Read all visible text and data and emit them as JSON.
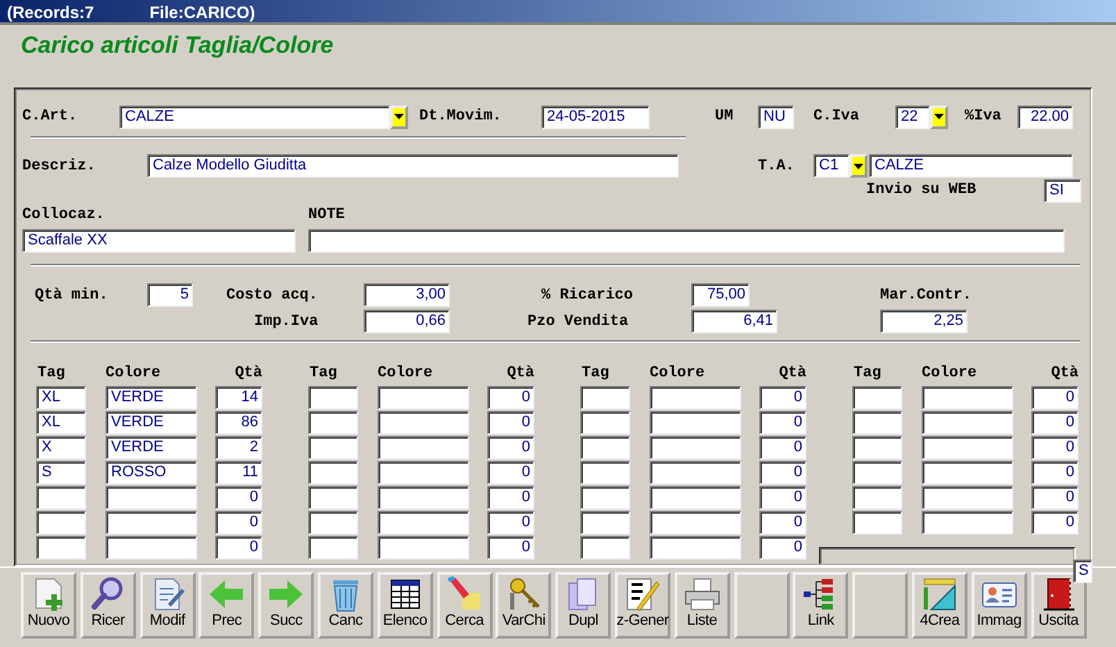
{
  "window": {
    "records": "(Records:7",
    "file": "File:CARICO)"
  },
  "heading": "Carico articoli Taglia/Colore",
  "article": {
    "label": "C.Art.",
    "value": "CALZE"
  },
  "date": {
    "label": "Dt.Movim.",
    "value": "24-05-2015"
  },
  "unit": {
    "label": "UM",
    "value": "NU"
  },
  "vat_code": {
    "label": "C.Iva",
    "value": "22"
  },
  "vat_rate": {
    "label": "%Iva",
    "value": "22.00"
  },
  "description": {
    "label": "Descriz.",
    "value": "Calze Modello Giuditta"
  },
  "product_type": {
    "label": "T.A.",
    "code": "C1",
    "name": "CALZE"
  },
  "web": {
    "label": "Invio su WEB",
    "value": "SI"
  },
  "location": {
    "label": "Collocaz.",
    "value": "Scaffale XX"
  },
  "notes": {
    "label": "NOTE"
  },
  "min_qty": {
    "label": "Qtà min.",
    "value": "5"
  },
  "cost": {
    "label": "Costo acq.",
    "value": "3,00"
  },
  "markup": {
    "label": "% Ricarico",
    "value": "75,00"
  },
  "margin": {
    "label": "Mar.Contr.",
    "value": "2,25"
  },
  "vat_amount": {
    "label": "Imp.Iva",
    "value": "0,66"
  },
  "sale_price": {
    "label": "Pzo Vendita",
    "value": "6,41"
  },
  "variant_groups": [
    {
      "columns": [
        "Tag",
        "Colore",
        "Qtà"
      ],
      "rows": [
        {
          "tag": "XL",
          "colour": "VERDE",
          "qty": "14"
        },
        {
          "tag": "XL",
          "colour": "VERDE",
          "qty": "86"
        },
        {
          "tag": "X",
          "colour": "VERDE",
          "qty": "2"
        },
        {
          "tag": "S",
          "colour": "ROSSO",
          "qty": "11"
        },
        {
          "qty": "0"
        },
        {
          "qty": "0"
        },
        {
          "qty": "0"
        }
      ]
    },
    {
      "columns": [
        "Tag",
        "Colore",
        "Qtà"
      ],
      "rows": [
        {
          "qty": "0"
        },
        {
          "qty": "0"
        },
        {
          "qty": "0"
        },
        {
          "qty": "0"
        },
        {
          "qty": "0"
        },
        {
          "qty": "0"
        },
        {
          "qty": "0"
        }
      ]
    },
    {
      "columns": [
        "Tag",
        "Colore",
        "Qtà"
      ],
      "rows": [
        {
          "qty": "0"
        },
        {
          "qty": "0"
        },
        {
          "qty": "0"
        },
        {
          "qty": "0"
        },
        {
          "qty": "0"
        },
        {
          "qty": "0"
        },
        {
          "qty": "0"
        }
      ]
    },
    {
      "columns": [
        "Tag",
        "Colore",
        "Qtà"
      ],
      "rows": [
        {
          "qty": "0"
        },
        {
          "qty": "0"
        },
        {
          "qty": "0"
        },
        {
          "qty": "0"
        },
        {
          "qty": "0"
        },
        {
          "qty": "0"
        }
      ]
    }
  ],
  "status_field": {
    "value": "S"
  },
  "toolbar": [
    {
      "label": "Nuovo",
      "kind": "new"
    },
    {
      "label": "Ricer",
      "kind": "search"
    },
    {
      "label": "Modif",
      "kind": "edit"
    },
    {
      "label": "Prec",
      "kind": "prev"
    },
    {
      "label": "Succ",
      "kind": "next"
    },
    {
      "label": "Canc",
      "kind": "trash"
    },
    {
      "label": "Elenco",
      "kind": "table"
    },
    {
      "label": "Cerca",
      "kind": "marker"
    },
    {
      "label": "VarChi",
      "kind": "keys"
    },
    {
      "label": "Dupl",
      "kind": "copy"
    },
    {
      "label": "z-Gener",
      "kind": "checklist"
    },
    {
      "label": "Liste",
      "kind": "print"
    },
    {
      "kind": "blank"
    },
    {
      "label": "Link",
      "kind": "tree"
    },
    {
      "kind": "blank"
    },
    {
      "label": "4Crea",
      "kind": "tools"
    },
    {
      "label": "Immag",
      "kind": "card"
    },
    {
      "label": "Uscita",
      "kind": "exit"
    }
  ]
}
